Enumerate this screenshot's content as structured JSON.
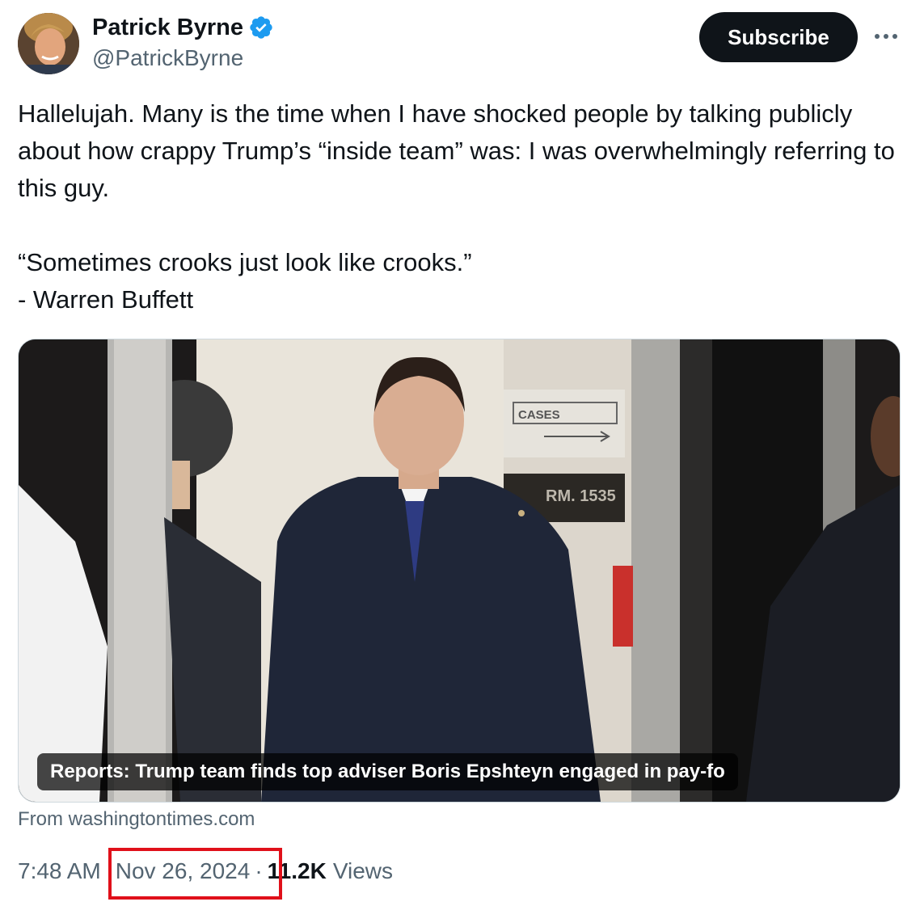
{
  "author": {
    "name": "Patrick Byrne",
    "handle": "@PatrickByrne",
    "verified": true
  },
  "actions": {
    "subscribe_label": "Subscribe",
    "more_icon": "more-horizontal-icon"
  },
  "tweet": {
    "paragraph1": "Hallelujah. Many is the time when I have shocked people by talking publicly about how crappy Trump’s “inside team” was: I was overwhelmingly referring to this guy.",
    "quote": "“Sometimes crooks just look like crooks.”",
    "attribution": "- Warren Buffett"
  },
  "link_card": {
    "headline": "Reports: Trump team finds top adviser Boris Epshteyn engaged in pay-fo",
    "source": "From washingtontimes.com",
    "sign_cases": "CASES",
    "sign_room": "RM. 1535"
  },
  "meta": {
    "time": "7:48 AM",
    "date": "Nov 26, 2024",
    "views_count": "11.2K",
    "views_label": "Views"
  },
  "colors": {
    "text": "#0f1419",
    "secondary": "#536471",
    "verified_blue": "#1d9bf0",
    "highlight_red": "#e0101a"
  }
}
